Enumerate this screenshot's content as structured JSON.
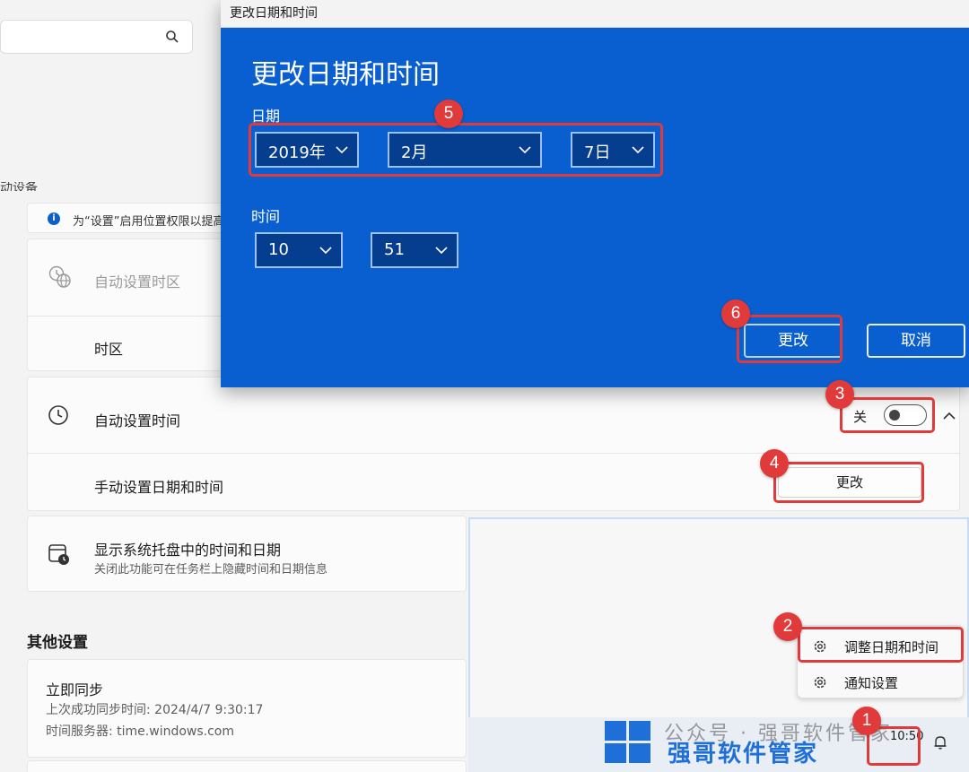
{
  "colors": {
    "dialog_bg": "#0a5fd0",
    "dropdown_bg": "#053d8f",
    "highlight": "#e03a3a",
    "info_accent": "#0a5fd0"
  },
  "search": {
    "icon": "search-icon"
  },
  "settings": {
    "partial_heading": "动设备",
    "info_text": "为“设置”启用位置权限以提高",
    "auto_timezone": "自动设置时区",
    "timezone": "时区",
    "auto_time": "自动设置时间",
    "auto_time_state": "关",
    "manual_time": "手动设置日期和时间",
    "change_button": "更改",
    "tray_title": "显示系统托盘中的时间和日期",
    "tray_sub": "关闭此功能可在任务栏上隐藏时间和日期信息",
    "other_heading": "其他设置",
    "sync_title": "立即同步",
    "sync_last": "上次成功同步时间: 2024/4/7 9:30:17",
    "sync_server": "时间服务器: time.windows.com"
  },
  "dialog": {
    "window_title": "更改日期和时间",
    "heading": "更改日期和时间",
    "date_label": "日期",
    "year": "2019年",
    "month": "2月",
    "day": "7日",
    "time_label": "时间",
    "hour": "10",
    "minute": "51",
    "change_button": "更改",
    "cancel_button": "取消"
  },
  "context_menu": {
    "adjust": "调整日期和时间",
    "notify": "通知设置"
  },
  "taskbar": {
    "clock": "10:50"
  },
  "watermark": {
    "line1": "公众号 · 强哥软件管家",
    "line2": "强哥软件管家"
  },
  "steps": [
    "1",
    "2",
    "3",
    "4",
    "5",
    "6"
  ]
}
